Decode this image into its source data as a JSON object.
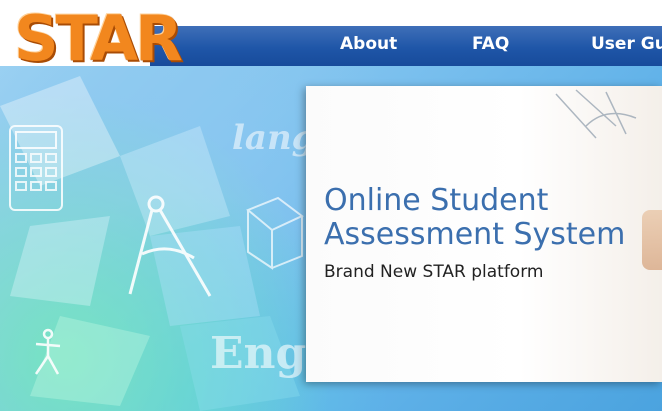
{
  "logo": {
    "text": "STAR"
  },
  "nav": {
    "about": "About",
    "faq": "FAQ",
    "user_guide": "User Gu"
  },
  "hero": {
    "title_line1": "Online Student",
    "title_line2": "Assessment System",
    "subtitle": "Brand New STAR platform",
    "bg_word_1": "langu",
    "bg_word_2": "Engli"
  },
  "colors": {
    "nav_bg": "#1f56a8",
    "logo_orange": "#f2871e",
    "title_blue": "#3b6fae"
  }
}
